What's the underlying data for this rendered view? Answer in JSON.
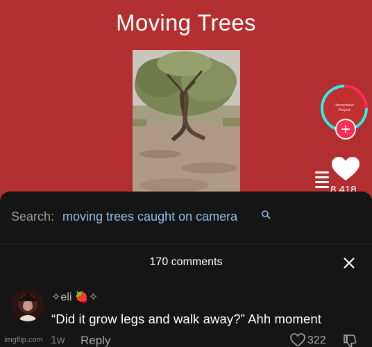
{
  "video": {
    "title": "Moving Trees",
    "creator_avatar_lines": [
      "Anonymous",
      "Project"
    ],
    "follow_label": "+",
    "like_count": "8,418",
    "colors": {
      "background": "#b22e31",
      "accent": "#fe2c55",
      "ring": "#25f4ee"
    }
  },
  "search": {
    "label": "Search:",
    "query": "moving trees caught on camera",
    "icon": "search-icon"
  },
  "comments": {
    "count_label": "170 comments",
    "close_icon": "close-icon",
    "items": [
      {
        "username": "✧eli 🍓✧",
        "text": "“Did it grow legs and walk away?” Ahh moment",
        "time": "1w",
        "reply_label": "Reply",
        "likes": "322"
      }
    ]
  },
  "watermark": "imgflip.com"
}
